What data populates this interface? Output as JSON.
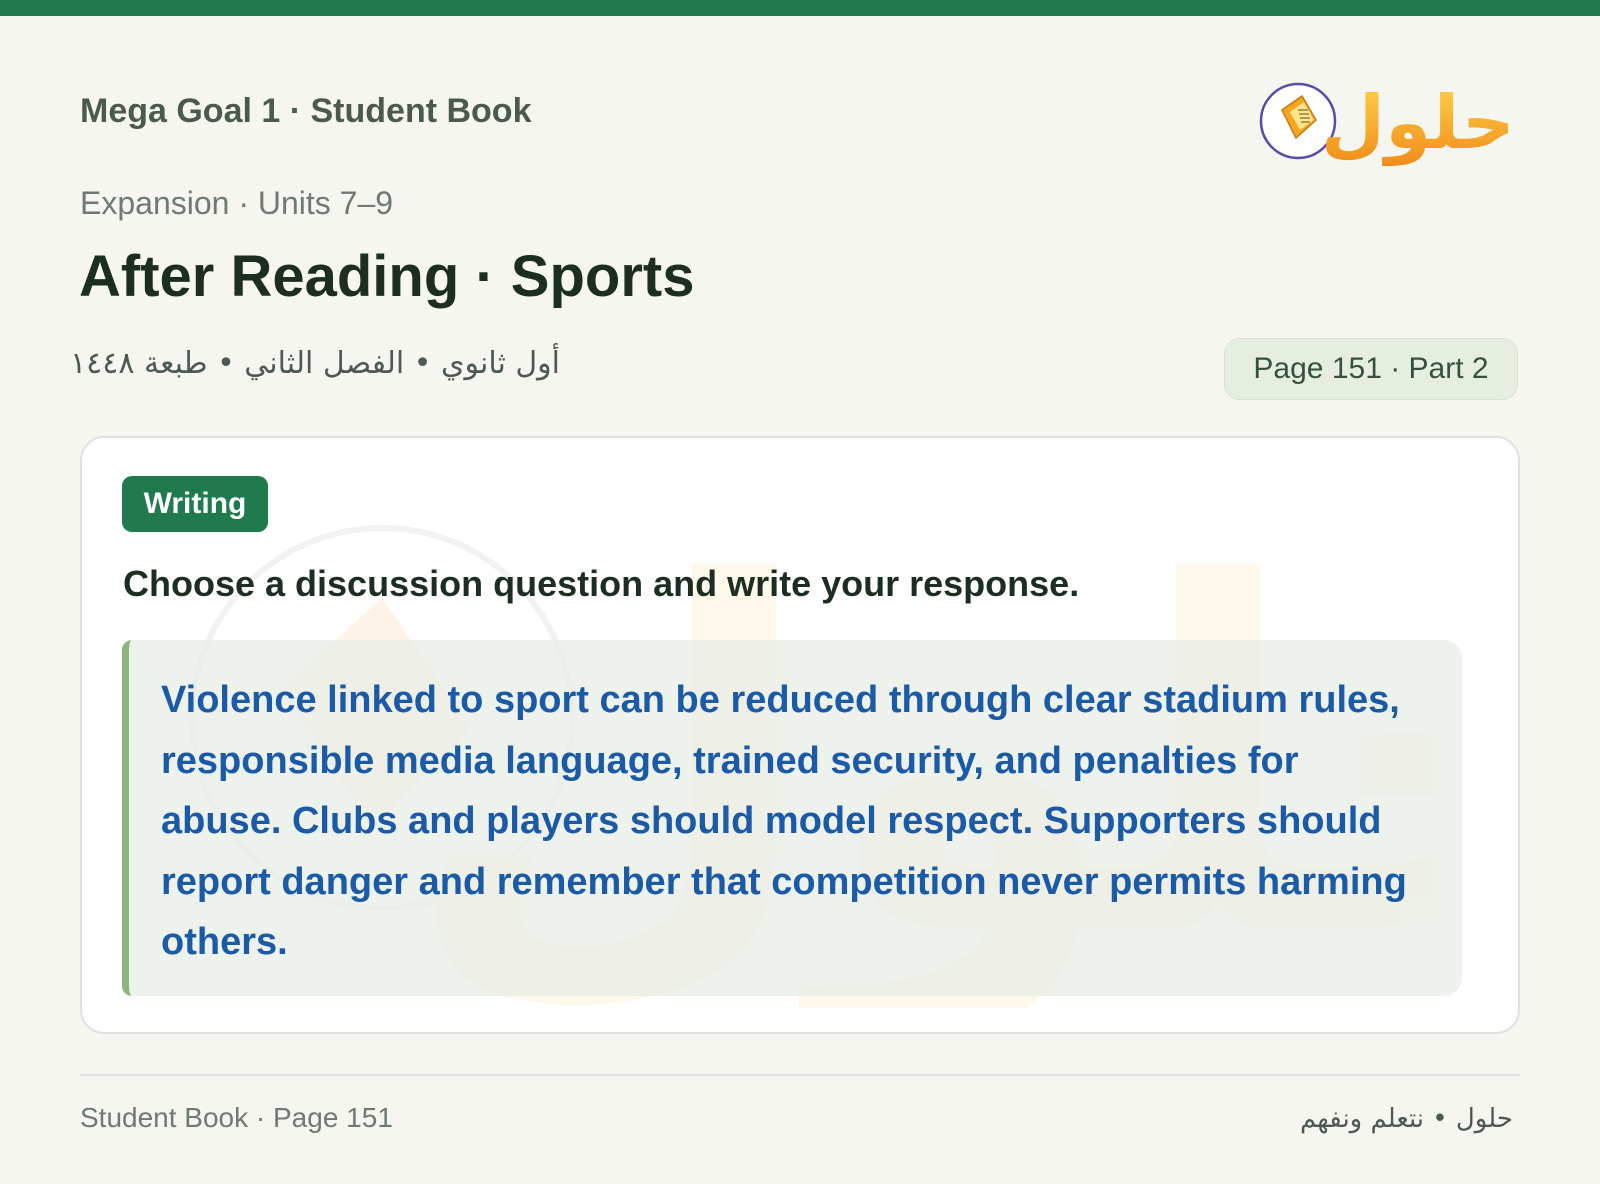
{
  "header": {
    "book_title": "Mega Goal 1 · Student Book",
    "unit_line": "Expansion · Units 7–9",
    "page_title": "After Reading · Sports",
    "arabic_subtitle": "أول ثانوي • الفصل الثاني • طبعة ١٤٤٨",
    "page_badge": "Page 151 · Part 2",
    "logo_text": "حلول",
    "logo_icon": "book-icon"
  },
  "section": {
    "badge": "Writing",
    "instruction": "Choose a discussion question and write your response.",
    "answer": "Violence linked to sport can be reduced through clear stadium rules, responsible media language, trained security, and penalties for abuse. Clubs and players should model respect. Supporters should report danger and remember that competition never permits harming others."
  },
  "footer": {
    "left": "Student Book · Page 151",
    "right": "حلول • نتعلم ونفهم"
  },
  "colors": {
    "accent_green": "#1f7a4d",
    "answer_blue": "#1a5aa7",
    "answer_bar": "#8fb57e",
    "logo_orange": "#f5a623",
    "page_background": "#f6f6f0"
  }
}
